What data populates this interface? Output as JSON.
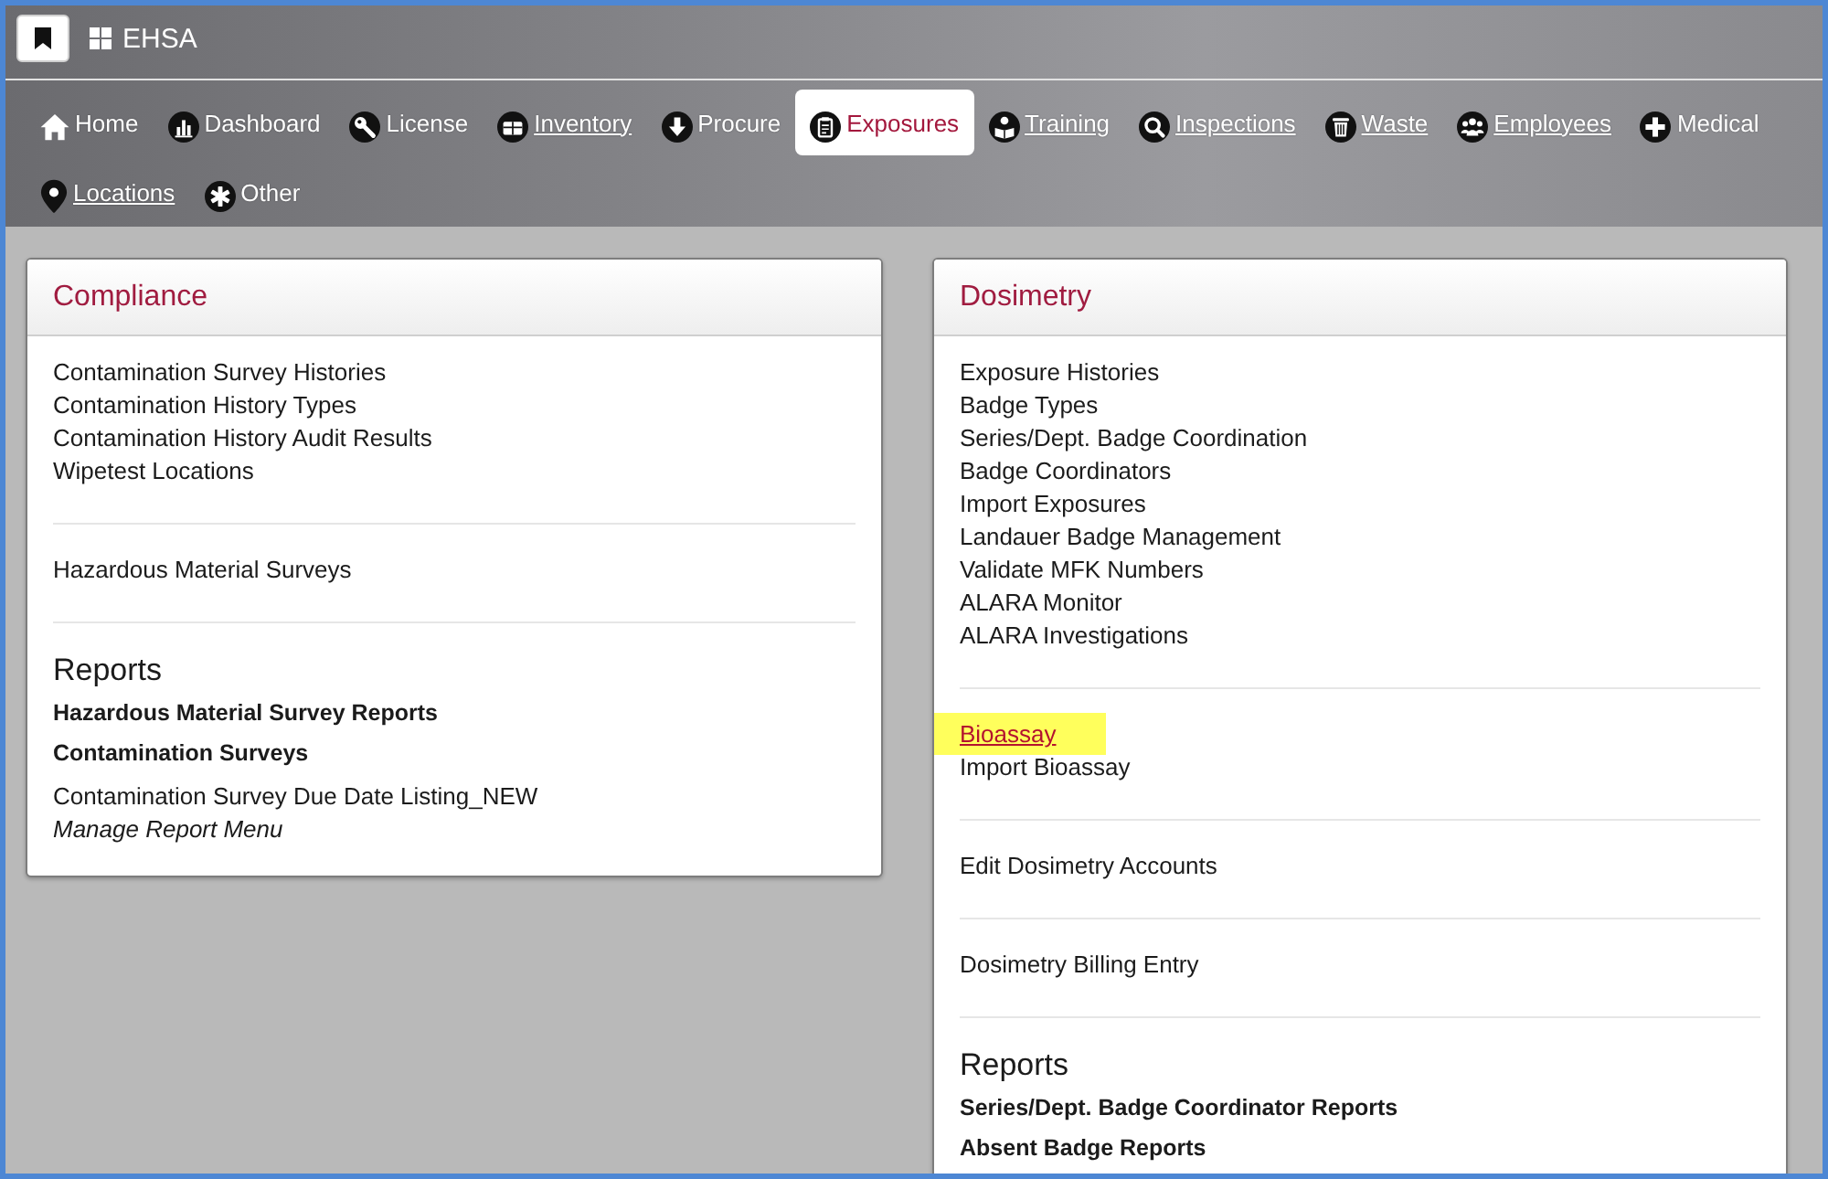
{
  "app": {
    "title": "EHSA"
  },
  "nav": [
    {
      "label": "Home",
      "selected": false,
      "underlined": false
    },
    {
      "label": "Dashboard",
      "selected": false,
      "underlined": false
    },
    {
      "label": "License",
      "selected": false,
      "underlined": false
    },
    {
      "label": "Inventory",
      "selected": false,
      "underlined": true
    },
    {
      "label": "Procure",
      "selected": false,
      "underlined": false
    },
    {
      "label": "Exposures",
      "selected": true,
      "underlined": false
    },
    {
      "label": "Training",
      "selected": false,
      "underlined": true
    },
    {
      "label": "Inspections",
      "selected": false,
      "underlined": true
    },
    {
      "label": "Waste",
      "selected": false,
      "underlined": true
    },
    {
      "label": "Employees",
      "selected": false,
      "underlined": true
    },
    {
      "label": "Medical",
      "selected": false,
      "underlined": false
    },
    {
      "label": "Locations",
      "selected": false,
      "underlined": true
    },
    {
      "label": "Other",
      "selected": false,
      "underlined": false
    }
  ],
  "panels": [
    {
      "title": "Compliance",
      "sections": [
        {
          "kind": "links",
          "items": [
            {
              "label": "Contamination Survey Histories",
              "highlighted": false
            },
            {
              "label": "Contamination History Types",
              "highlighted": false
            },
            {
              "label": "Contamination History Audit Results",
              "highlighted": false
            },
            {
              "label": "Wipetest Locations",
              "highlighted": false
            }
          ]
        },
        {
          "kind": "links",
          "items": [
            {
              "label": "Hazardous Material Surveys",
              "highlighted": false
            }
          ]
        },
        {
          "kind": "reports",
          "heading": "Reports",
          "items": [
            {
              "kind": "group",
              "label": "Hazardous Material Survey Reports"
            },
            {
              "kind": "group",
              "label": "Contamination Surveys"
            },
            {
              "kind": "report",
              "label": "Contamination Survey Due Date Listing_NEW"
            },
            {
              "kind": "manage",
              "label": "Manage Report Menu"
            }
          ]
        }
      ]
    },
    {
      "title": "Dosimetry",
      "sections": [
        {
          "kind": "links",
          "items": [
            {
              "label": "Exposure Histories",
              "highlighted": false
            },
            {
              "label": "Badge Types",
              "highlighted": false
            },
            {
              "label": "Series/Dept. Badge Coordination",
              "highlighted": false
            },
            {
              "label": "Badge Coordinators",
              "highlighted": false
            },
            {
              "label": "Import Exposures",
              "highlighted": false
            },
            {
              "label": "Landauer Badge Management",
              "highlighted": false
            },
            {
              "label": "Validate MFK Numbers",
              "highlighted": false
            },
            {
              "label": "ALARA Monitor",
              "highlighted": false
            },
            {
              "label": "ALARA Investigations",
              "highlighted": false
            }
          ]
        },
        {
          "kind": "links",
          "items": [
            {
              "label": "Bioassay",
              "highlighted": true
            },
            {
              "label": "Import Bioassay",
              "highlighted": false
            }
          ]
        },
        {
          "kind": "links",
          "items": [
            {
              "label": "Edit Dosimetry Accounts",
              "highlighted": false
            }
          ]
        },
        {
          "kind": "links",
          "items": [
            {
              "label": "Dosimetry Billing Entry",
              "highlighted": false
            }
          ]
        },
        {
          "kind": "reports",
          "heading": "Reports",
          "items": [
            {
              "kind": "group",
              "label": "Series/Dept. Badge Coordinator Reports"
            },
            {
              "kind": "group",
              "label": "Absent Badge Reports"
            }
          ]
        }
      ]
    }
  ]
}
